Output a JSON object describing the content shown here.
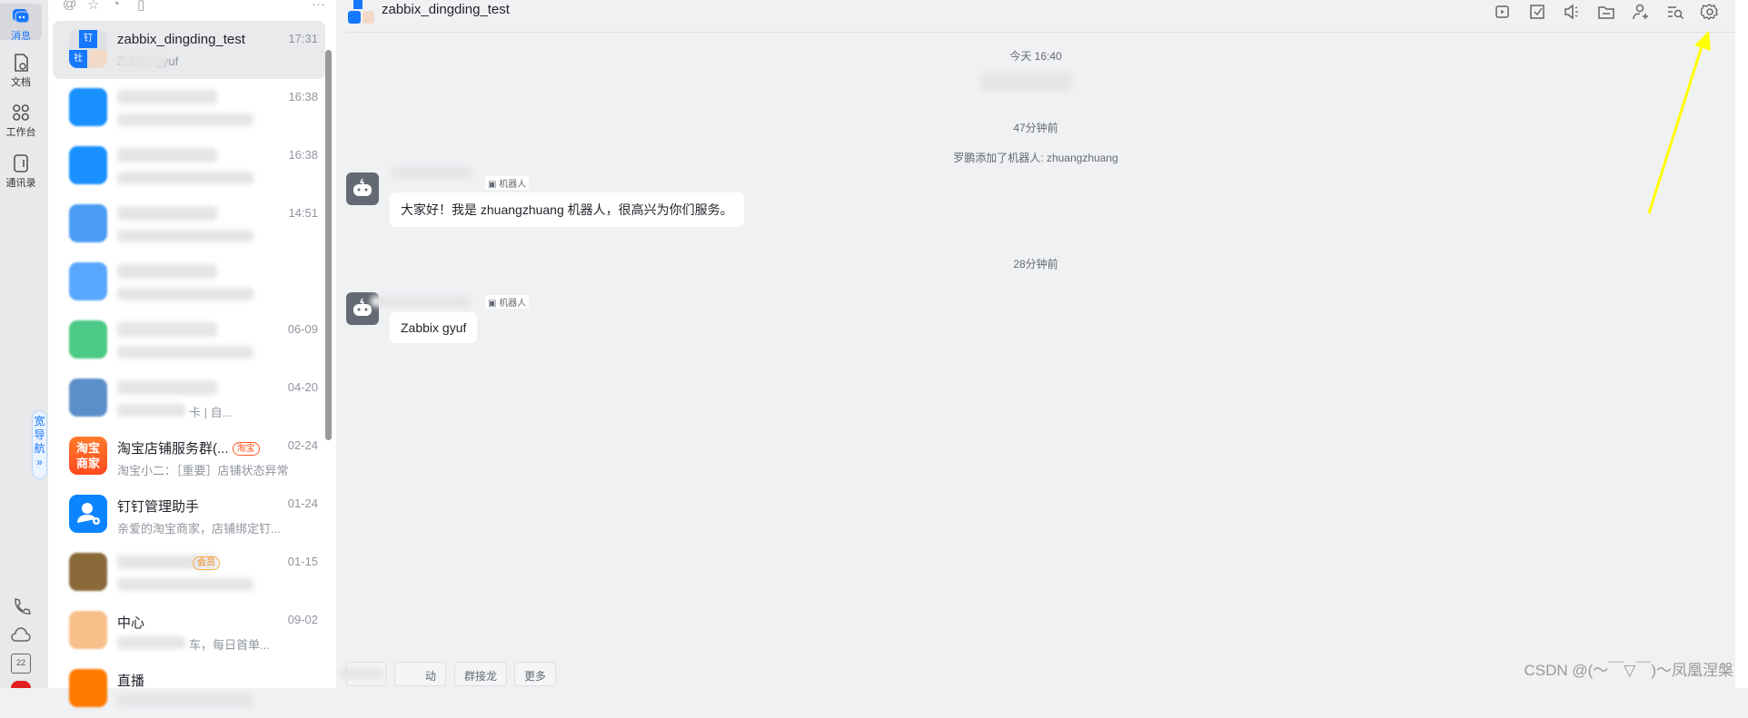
{
  "rail": {
    "items": [
      {
        "label": "消息"
      },
      {
        "label": "文档"
      },
      {
        "label": "工作台"
      },
      {
        "label": "通讯录"
      }
    ],
    "wide_nav": "宽导航",
    "wide_nav_arrow": "»",
    "calendar_day": "22"
  },
  "list": {
    "items": [
      {
        "name": "zabbix_dingding_test",
        "preview": "Zabbix gyuf",
        "time": "17:31",
        "avatar_char1": "钉",
        "avatar_char2": "社"
      },
      {
        "time": "16:38"
      },
      {
        "time": "16:38"
      },
      {
        "time": "14:51"
      },
      {
        "time": ""
      },
      {
        "time": "06-09"
      },
      {
        "preview": "卡 | 自...",
        "time": "04-20"
      },
      {
        "name": "淘宝店铺服务群(...",
        "tag": "淘宝",
        "preview": "淘宝小二：［重要］店铺状态异常",
        "time": "02-24",
        "avatar_text": "淘宝商家"
      },
      {
        "name": "钉钉管理助手",
        "preview": "亲爱的淘宝商家，店铺绑定钉...",
        "time": "01-24"
      },
      {
        "tag": "会员",
        "time": "01-15"
      },
      {
        "name": "中心",
        "preview": "车，每日首单...",
        "time": "09-02"
      },
      {
        "name": "直播",
        "time": ""
      }
    ]
  },
  "chat": {
    "title": "zabbix_dingding_test",
    "timestamps": [
      "今天 16:40",
      "47分钟前",
      "28分钟前"
    ],
    "system_message": "罗鹏添加了机器人: zhuangzhuang",
    "robot_tag": "机器人",
    "messages": [
      {
        "text": "大家好！我是 zhuangzhuang 机器人，很高兴为你们服务。"
      },
      {
        "text": "Zabbix gyuf"
      }
    ],
    "quick_buttons": [
      "",
      "动",
      "群接龙",
      "更多"
    ]
  },
  "watermark": "CSDN @(～￣▽￣)～凤凰涅槃",
  "colors": {
    "accent": "#1677ff",
    "chat_bg": "#f0f1f3",
    "annotation_arrow": "#ffff00"
  }
}
